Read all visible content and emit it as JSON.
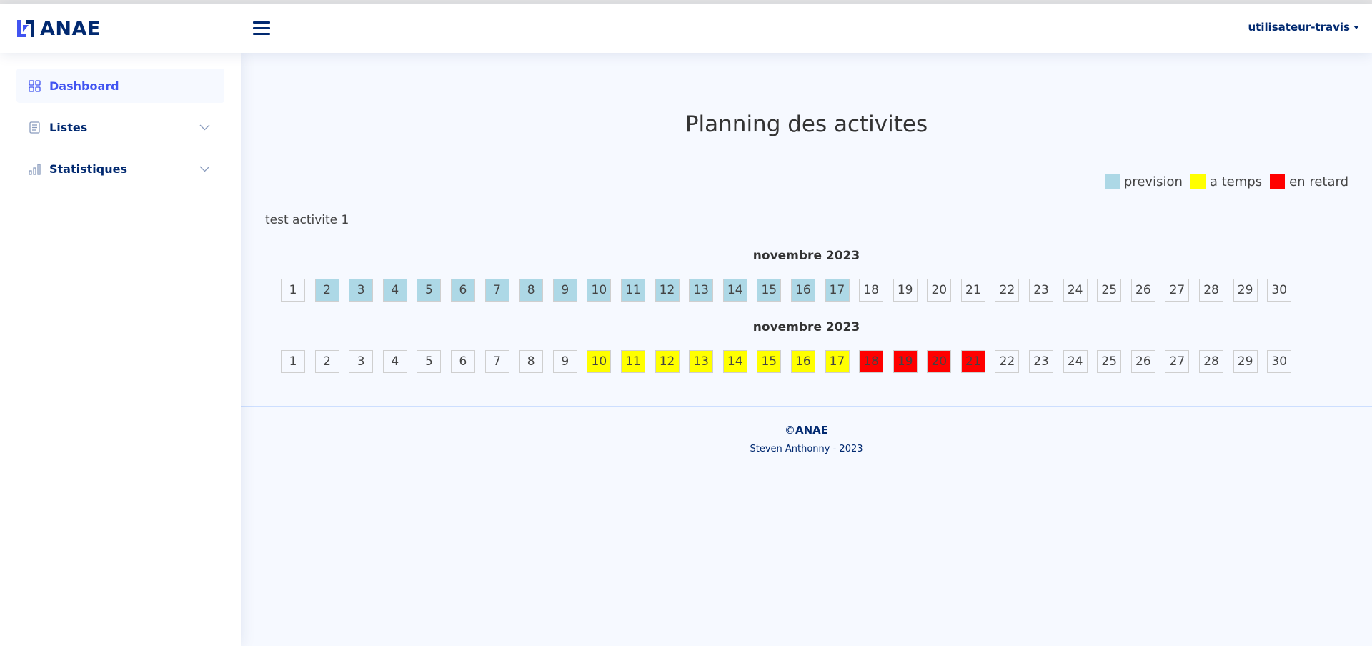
{
  "brand": {
    "name": "ANAE",
    "logo_icon": "anae-logo-icon"
  },
  "header": {
    "menu_icon": "hamburger-icon",
    "user_name": "utilisateur-travis"
  },
  "sidebar": {
    "items": [
      {
        "label": "Dashboard",
        "icon": "grid-icon",
        "active": true,
        "has_submenu": false
      },
      {
        "label": "Listes",
        "icon": "list-doc-icon",
        "active": false,
        "has_submenu": true
      },
      {
        "label": "Statistiques",
        "icon": "bar-chart-icon",
        "active": false,
        "has_submenu": true
      }
    ]
  },
  "main": {
    "title": "Planning des activites",
    "legend": [
      {
        "label": "prevision",
        "color": "#add8e6"
      },
      {
        "label": "a temps",
        "color": "#ffff00"
      },
      {
        "label": "en retard",
        "color": "#ff0000"
      }
    ],
    "activity_name": "test activite 1",
    "rows": [
      {
        "month": "novembre 2023",
        "days": [
          {
            "d": "1",
            "s": ""
          },
          {
            "d": "2",
            "s": "prevision"
          },
          {
            "d": "3",
            "s": "prevision"
          },
          {
            "d": "4",
            "s": "prevision"
          },
          {
            "d": "5",
            "s": "prevision"
          },
          {
            "d": "6",
            "s": "prevision"
          },
          {
            "d": "7",
            "s": "prevision"
          },
          {
            "d": "8",
            "s": "prevision"
          },
          {
            "d": "9",
            "s": "prevision"
          },
          {
            "d": "10",
            "s": "prevision"
          },
          {
            "d": "11",
            "s": "prevision"
          },
          {
            "d": "12",
            "s": "prevision"
          },
          {
            "d": "13",
            "s": "prevision"
          },
          {
            "d": "14",
            "s": "prevision"
          },
          {
            "d": "15",
            "s": "prevision"
          },
          {
            "d": "16",
            "s": "prevision"
          },
          {
            "d": "17",
            "s": "prevision"
          },
          {
            "d": "18",
            "s": ""
          },
          {
            "d": "19",
            "s": ""
          },
          {
            "d": "20",
            "s": ""
          },
          {
            "d": "21",
            "s": ""
          },
          {
            "d": "22",
            "s": ""
          },
          {
            "d": "23",
            "s": ""
          },
          {
            "d": "24",
            "s": ""
          },
          {
            "d": "25",
            "s": ""
          },
          {
            "d": "26",
            "s": ""
          },
          {
            "d": "27",
            "s": ""
          },
          {
            "d": "28",
            "s": ""
          },
          {
            "d": "29",
            "s": ""
          },
          {
            "d": "30",
            "s": ""
          }
        ]
      },
      {
        "month": "novembre 2023",
        "days": [
          {
            "d": "1",
            "s": ""
          },
          {
            "d": "2",
            "s": ""
          },
          {
            "d": "3",
            "s": ""
          },
          {
            "d": "4",
            "s": ""
          },
          {
            "d": "5",
            "s": ""
          },
          {
            "d": "6",
            "s": ""
          },
          {
            "d": "7",
            "s": ""
          },
          {
            "d": "8",
            "s": ""
          },
          {
            "d": "9",
            "s": ""
          },
          {
            "d": "10",
            "s": "atemps"
          },
          {
            "d": "11",
            "s": "atemps"
          },
          {
            "d": "12",
            "s": "atemps"
          },
          {
            "d": "13",
            "s": "atemps"
          },
          {
            "d": "14",
            "s": "atemps"
          },
          {
            "d": "15",
            "s": "atemps"
          },
          {
            "d": "16",
            "s": "atemps"
          },
          {
            "d": "17",
            "s": "atemps"
          },
          {
            "d": "18",
            "s": "retard"
          },
          {
            "d": "19",
            "s": "retard"
          },
          {
            "d": "20",
            "s": "retard"
          },
          {
            "d": "21",
            "s": "retard"
          },
          {
            "d": "22",
            "s": ""
          },
          {
            "d": "23",
            "s": ""
          },
          {
            "d": "24",
            "s": ""
          },
          {
            "d": "25",
            "s": ""
          },
          {
            "d": "26",
            "s": ""
          },
          {
            "d": "27",
            "s": ""
          },
          {
            "d": "28",
            "s": ""
          },
          {
            "d": "29",
            "s": ""
          },
          {
            "d": "30",
            "s": ""
          }
        ]
      }
    ]
  },
  "footer": {
    "copyright_symbol": "©",
    "brand": "ANAE",
    "credits": "Steven Anthonny - 2023"
  },
  "colors": {
    "navy": "#012970",
    "accent": "#4154f1",
    "background": "#f6f9ff"
  }
}
